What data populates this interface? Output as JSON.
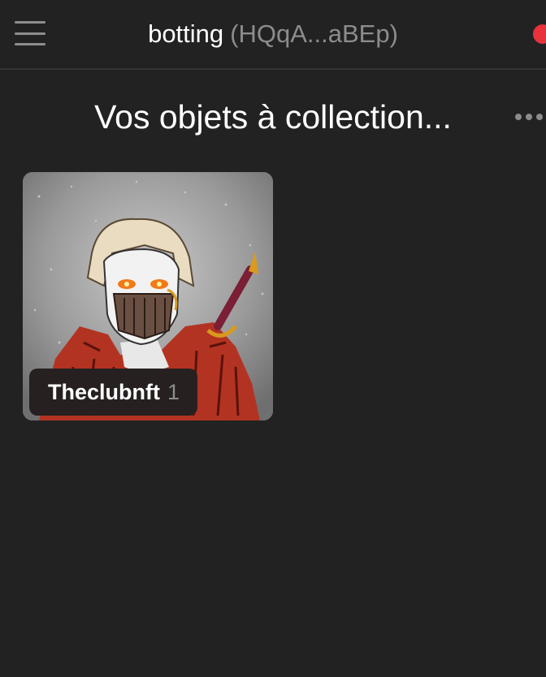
{
  "header": {
    "wallet_name": "botting",
    "wallet_address": "(HQqA...aBEp)",
    "menu_icon": "hamburger-menu-icon",
    "status_color": "#e8323c"
  },
  "main": {
    "title": "Vos objets à collection...",
    "more_icon": "more-horizontal-icon",
    "collections": [
      {
        "name": "Theclubnft",
        "count": "1"
      }
    ]
  }
}
